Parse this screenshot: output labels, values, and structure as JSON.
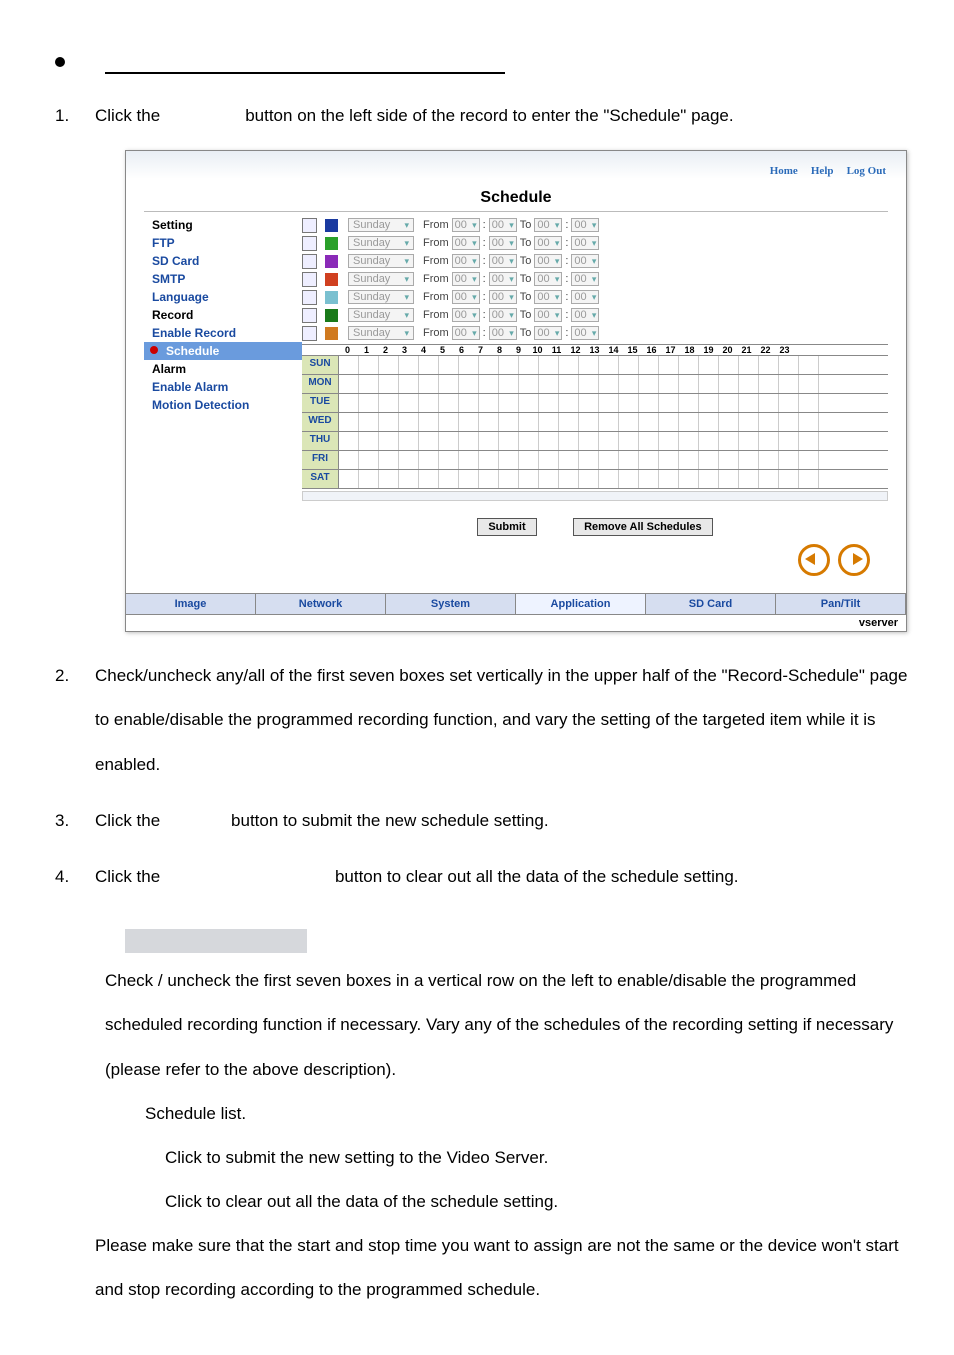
{
  "bullet_section_title": "",
  "steps": {
    "1": "Click the                  button on the left side of the record to enter the \"Schedule\" page.",
    "2": "Check/uncheck any/all of the first seven boxes set vertically in the upper half of the \"Record-Schedule\" page to enable/disable the programmed recording function, and vary the setting of the targeted item while it is enabled.",
    "3": "Click the               button to submit the new schedule setting.",
    "4": "Click the                                     button to clear out all the data of the schedule setting."
  },
  "shot": {
    "toplinks": {
      "home": "Home",
      "help": "Help",
      "logout": "Log Out"
    },
    "panel_title": "Schedule",
    "sidebar": {
      "items": [
        {
          "label": "Setting",
          "class": "black"
        },
        {
          "label": "FTP"
        },
        {
          "label": "SD Card"
        },
        {
          "label": "SMTP"
        },
        {
          "label": "Language"
        },
        {
          "label": "Record",
          "class": "black"
        },
        {
          "label": "Enable Record"
        },
        {
          "label": "Schedule",
          "class": "sel"
        },
        {
          "label": "Alarm",
          "class": "black"
        },
        {
          "label": "Enable Alarm"
        },
        {
          "label": "Motion Detection"
        }
      ]
    },
    "day_select": "Sunday",
    "from_label": "From",
    "to_label": "To",
    "val": "00",
    "hours": [
      "0",
      "1",
      "2",
      "3",
      "4",
      "5",
      "6",
      "7",
      "8",
      "9",
      "10",
      "11",
      "12",
      "13",
      "14",
      "15",
      "16",
      "17",
      "18",
      "19",
      "20",
      "21",
      "22",
      "23"
    ],
    "days": [
      "SUN",
      "MON",
      "TUE",
      "WED",
      "THU",
      "FRI",
      "SAT"
    ],
    "btn_submit": "Submit",
    "btn_remove": "Remove All Schedules",
    "tabs": [
      "Image",
      "Network",
      "System",
      "Application",
      "SD Card",
      "Pan/Tilt"
    ],
    "tab_selected": 3,
    "footer": "vserver"
  },
  "description_title": "",
  "desc": {
    "chk": "             Check / uncheck the first seven boxes in a vertical row on the left to enable/disable the programmed scheduled recording function if necessary. Vary any of the schedules of the recording setting if necessary (please refer to the above description).",
    "list": "Schedule list.",
    "submit": "   Click to submit the new setting to the Video Server.",
    "remove": "                           Click to clear out all the data of the schedule setting."
  },
  "note": "Please make sure that the start and stop time you want to assign are not the same or the device won't start and stop recording according to the programmed schedule."
}
